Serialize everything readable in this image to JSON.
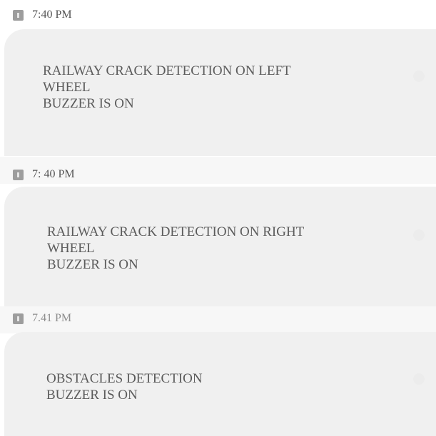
{
  "messages": [
    {
      "time": "7:40 PM",
      "text": "RAILWAY CRACK DETECTION ON LEFT\nWHEEL\nBUZZER IS ON"
    },
    {
      "time": "7: 40 PM",
      "text": "RAILWAY CRACK DETECTION ON RIGHT\nWHEEL\nBUZZER IS ON"
    },
    {
      "time": "7.41 PM",
      "text": "OBSTACLES  DETECTION\nBUZZER IS ON"
    }
  ],
  "icons": {
    "sim": "sim-card-icon"
  },
  "colors": {
    "bubble": "#f0f0f0",
    "sim_icon": "#9d9d9d",
    "text": "#5b5b5b"
  }
}
